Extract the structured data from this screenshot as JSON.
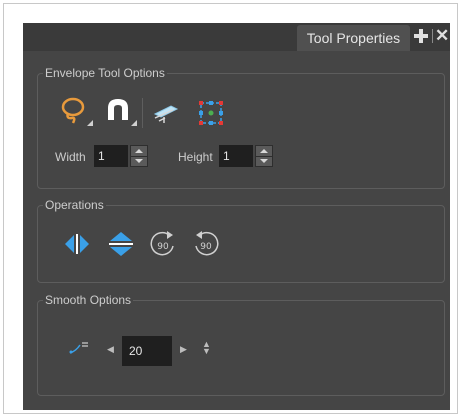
{
  "panel": {
    "tab_label": "Tool Properties"
  },
  "envelope": {
    "title": "Envelope Tool Options",
    "width_label": "Width",
    "width_value": "1",
    "height_label": "Height",
    "height_value": "1",
    "icons": [
      "lasso-select-icon",
      "magnet-icon",
      "contour-editor-icon",
      "bounding-box-icon"
    ]
  },
  "operations": {
    "title": "Operations",
    "icons": [
      "flip-horizontal-icon",
      "flip-vertical-icon",
      "rotate-90-cw-icon",
      "rotate-90-ccw-icon"
    ]
  },
  "smooth": {
    "title": "Smooth Options",
    "value": "20",
    "icons": [
      "smooth-icon"
    ]
  },
  "colors": {
    "panel_bg": "#454545",
    "accent_blue": "#3aa0e8",
    "lasso_orange": "#e89a3c"
  }
}
